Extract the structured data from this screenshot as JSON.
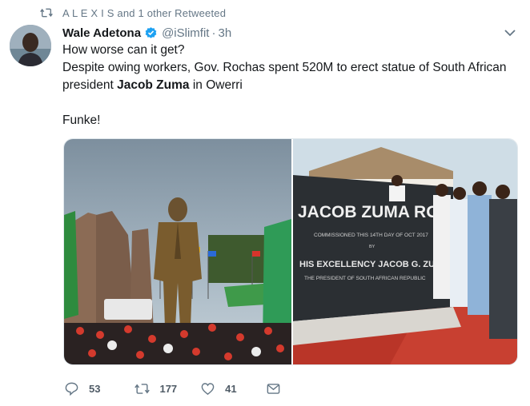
{
  "retweet": {
    "text": "A L E X I S and 1 other Retweeted"
  },
  "tweet": {
    "name": "Wale Adetona",
    "handle": "@iSlimfit",
    "separator": "·",
    "time": "3h",
    "line1": "How worse can it get?",
    "line2_pre": "Despite owing workers, Gov. Rochas spent 520M to erect statue of South African president ",
    "line2_bold": "Jacob Zuma",
    "line2_post": " in Owerri",
    "line3": "Funke!"
  },
  "media": {
    "right_sign": {
      "title": "JACOB ZUMA ROAD",
      "commissioned": "COMMISSIONED THIS 14TH DAY OF OCT 2017",
      "by": "BY",
      "excellency": "HIS EXCELLENCY JACOB G. ZUMA",
      "president": "THE PRESIDENT OF SOUTH AFRICAN REPUBLIC"
    }
  },
  "actions": {
    "replies": "53",
    "retweets": "177",
    "likes": "41"
  },
  "colors": {
    "text": "#14171a",
    "secondary": "#657786",
    "verified": "#1da1f2"
  },
  "icons": [
    "retweet-icon",
    "verified-icon",
    "caret-down-icon",
    "reply-icon",
    "retweet-action-icon",
    "like-icon",
    "message-icon"
  ]
}
